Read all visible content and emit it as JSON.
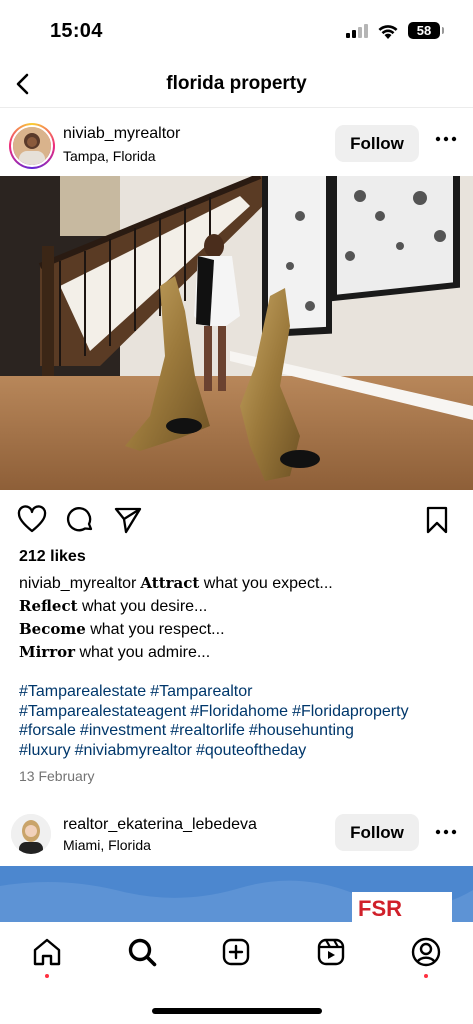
{
  "status_bar": {
    "time": "15:04",
    "battery": "58"
  },
  "header": {
    "title": "florida property"
  },
  "post1": {
    "username": "niviab_myrealtor",
    "location": "Tampa, Florida",
    "follow_label": "Follow",
    "likes": "212 likes",
    "caption_user": "niviab_myrealtor",
    "caption_lines": [
      {
        "bold": "Attract",
        "rest": " what you expect..."
      },
      {
        "bold": "Reflect",
        "rest": " what you desire..."
      },
      {
        "bold": "Become",
        "rest": " what you respect..."
      },
      {
        "bold": "Mirror",
        "rest": " what you admire..."
      }
    ],
    "hashtags": [
      "#Tamparealestate",
      "#Tamparealtor",
      "#Tamparealestateagent",
      "#Floridahome",
      "#Floridaproperty",
      "#forsale",
      "#investment",
      "#realtorlife",
      "#househunting",
      "#luxury",
      "#niviabmyrealtor",
      "#qouteoftheday"
    ],
    "date": "13 February"
  },
  "post2": {
    "username": "realtor_ekaterina_lebedeva",
    "location": "Miami, Florida",
    "follow_label": "Follow",
    "logo_text": "FSR"
  },
  "icons": {
    "back": "chevron-left-icon",
    "more": "more-horizontal-icon",
    "like": "heart-icon",
    "comment": "comment-icon",
    "share": "send-icon",
    "save": "bookmark-icon",
    "tabs": [
      "home-icon",
      "search-icon",
      "create-icon",
      "reels-icon",
      "profile-icon"
    ]
  },
  "colors": {
    "link": "#00376b",
    "notification_dot": "#ff3040",
    "follow_bg": "#efefef"
  }
}
